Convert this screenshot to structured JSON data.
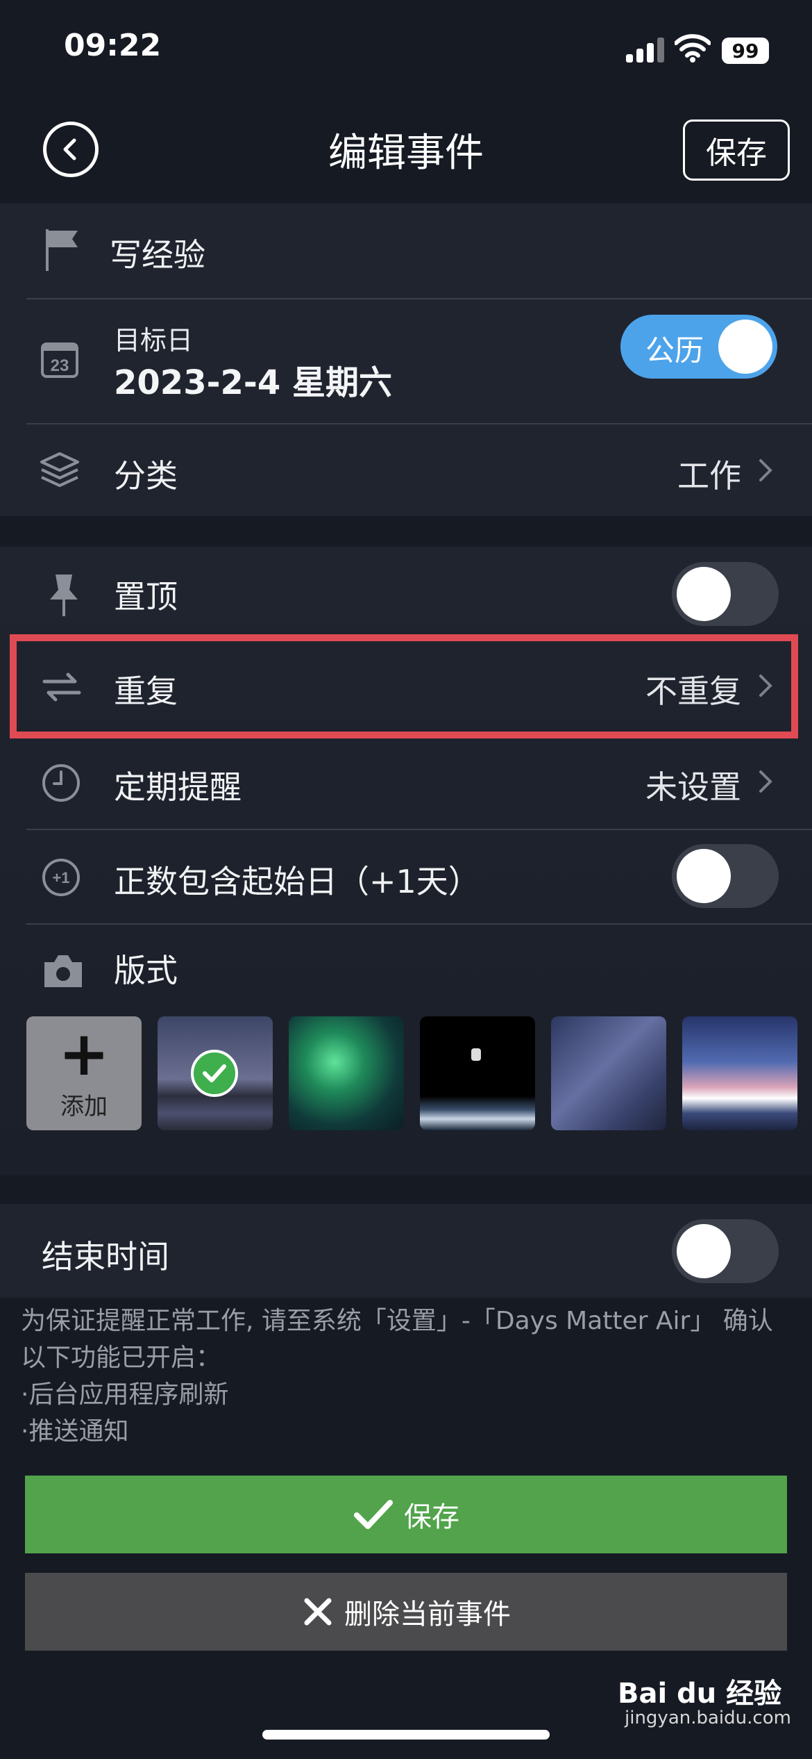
{
  "status": {
    "time": "09:22",
    "battery": "99"
  },
  "nav": {
    "title": "编辑事件",
    "save": "保存"
  },
  "event": {
    "name": "写经验"
  },
  "target_date": {
    "label": "目标日",
    "value": "2023-2-4 星期六",
    "calendar_toggle": "公历",
    "calendar_icon_day": "23"
  },
  "category": {
    "label": "分类",
    "value": "工作"
  },
  "pin": {
    "label": "置顶",
    "on": false
  },
  "repeat": {
    "label": "重复",
    "value": "不重复"
  },
  "reminder": {
    "label": "定期提醒",
    "value": "未设置"
  },
  "count_start": {
    "label": "正数包含起始日（+1天）",
    "on": false,
    "icon_text": "+1"
  },
  "style": {
    "label": "版式",
    "add_label": "添加"
  },
  "end_time": {
    "label": "结束时间",
    "on": false
  },
  "notice": {
    "line1": "为保证提醒正常工作, 请至系统「设置」-「Days Matter Air」 确认以下功能已开启：",
    "line2": "·后台应用程序刷新",
    "line3": "·推送通知"
  },
  "buttons": {
    "save": "保存",
    "delete": "删除当前事件"
  },
  "watermark": {
    "brand": "Bai du 经验",
    "url": "jingyan.baidu.com"
  },
  "colors": {
    "accent_blue": "#4da3ea",
    "save_green": "#52a34b",
    "highlight_red": "#e04b53"
  }
}
